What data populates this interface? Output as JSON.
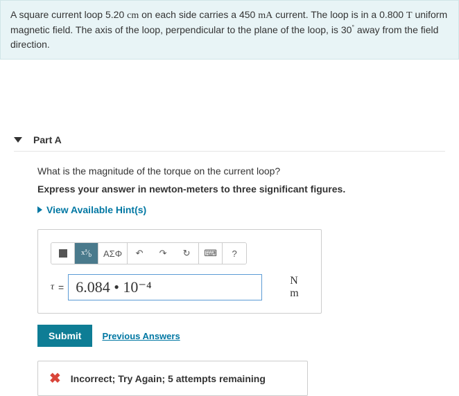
{
  "problem": {
    "text_before_length": "A square current loop ",
    "length_value": "5.20",
    "length_unit": "cm",
    "text_mid1": " on each side carries a ",
    "current_value": "450",
    "current_unit": "mA",
    "text_mid2": " current. The loop is in a ",
    "field_value": "0.800",
    "field_unit": "T",
    "text_mid3": " uniform magnetic field. The axis of the loop, perpendicular to the plane of the loop, is ",
    "angle_value": "30",
    "angle_deg": "°",
    "text_end": " away from the field direction."
  },
  "part": {
    "label": "Part A",
    "question": "What is the magnitude of the torque on the current loop?",
    "instruction": "Express your answer in newton-meters to three significant figures.",
    "hints_label": "View Available Hint(s)"
  },
  "toolbar": {
    "greek_label": "ΑΣΦ",
    "undo_glyph": "↶",
    "redo_glyph": "↷",
    "reset_glyph": "↻",
    "keyboard_glyph": "⌨",
    "help_glyph": "?"
  },
  "answer": {
    "var": "τ",
    "equals": "=",
    "value": "6.084 • 10⁻⁴",
    "units": "N m"
  },
  "buttons": {
    "submit": "Submit",
    "previous": "Previous Answers"
  },
  "feedback": {
    "icon": "✖",
    "message": "Incorrect; Try Again; 5 attempts remaining"
  }
}
